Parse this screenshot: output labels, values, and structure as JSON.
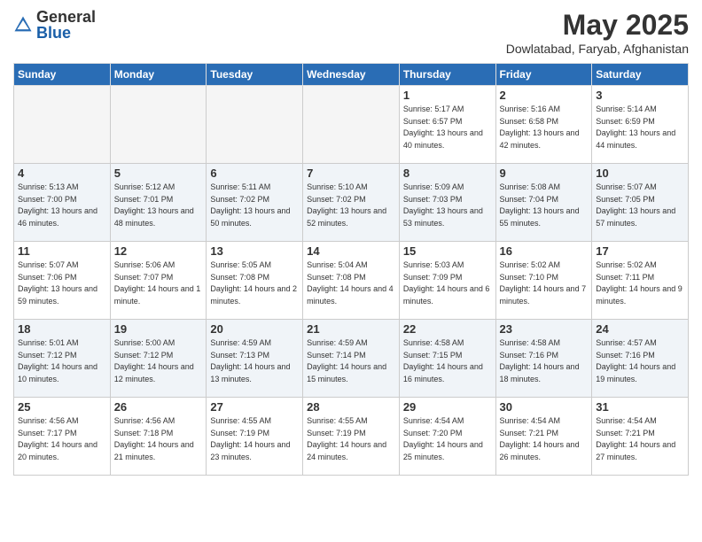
{
  "logo": {
    "general": "General",
    "blue": "Blue"
  },
  "title": {
    "month_year": "May 2025",
    "location": "Dowlatabad, Faryab, Afghanistan"
  },
  "weekdays": [
    "Sunday",
    "Monday",
    "Tuesday",
    "Wednesday",
    "Thursday",
    "Friday",
    "Saturday"
  ],
  "weeks": [
    [
      {
        "day": "",
        "empty": true
      },
      {
        "day": "",
        "empty": true
      },
      {
        "day": "",
        "empty": true
      },
      {
        "day": "",
        "empty": true
      },
      {
        "day": "1",
        "sunrise": "5:17 AM",
        "sunset": "6:57 PM",
        "daylight": "13 hours and 40 minutes."
      },
      {
        "day": "2",
        "sunrise": "5:16 AM",
        "sunset": "6:58 PM",
        "daylight": "13 hours and 42 minutes."
      },
      {
        "day": "3",
        "sunrise": "5:14 AM",
        "sunset": "6:59 PM",
        "daylight": "13 hours and 44 minutes."
      }
    ],
    [
      {
        "day": "4",
        "sunrise": "5:13 AM",
        "sunset": "7:00 PM",
        "daylight": "13 hours and 46 minutes."
      },
      {
        "day": "5",
        "sunrise": "5:12 AM",
        "sunset": "7:01 PM",
        "daylight": "13 hours and 48 minutes."
      },
      {
        "day": "6",
        "sunrise": "5:11 AM",
        "sunset": "7:02 PM",
        "daylight": "13 hours and 50 minutes."
      },
      {
        "day": "7",
        "sunrise": "5:10 AM",
        "sunset": "7:02 PM",
        "daylight": "13 hours and 52 minutes."
      },
      {
        "day": "8",
        "sunrise": "5:09 AM",
        "sunset": "7:03 PM",
        "daylight": "13 hours and 53 minutes."
      },
      {
        "day": "9",
        "sunrise": "5:08 AM",
        "sunset": "7:04 PM",
        "daylight": "13 hours and 55 minutes."
      },
      {
        "day": "10",
        "sunrise": "5:07 AM",
        "sunset": "7:05 PM",
        "daylight": "13 hours and 57 minutes."
      }
    ],
    [
      {
        "day": "11",
        "sunrise": "5:07 AM",
        "sunset": "7:06 PM",
        "daylight": "13 hours and 59 minutes."
      },
      {
        "day": "12",
        "sunrise": "5:06 AM",
        "sunset": "7:07 PM",
        "daylight": "14 hours and 1 minute."
      },
      {
        "day": "13",
        "sunrise": "5:05 AM",
        "sunset": "7:08 PM",
        "daylight": "14 hours and 2 minutes."
      },
      {
        "day": "14",
        "sunrise": "5:04 AM",
        "sunset": "7:08 PM",
        "daylight": "14 hours and 4 minutes."
      },
      {
        "day": "15",
        "sunrise": "5:03 AM",
        "sunset": "7:09 PM",
        "daylight": "14 hours and 6 minutes."
      },
      {
        "day": "16",
        "sunrise": "5:02 AM",
        "sunset": "7:10 PM",
        "daylight": "14 hours and 7 minutes."
      },
      {
        "day": "17",
        "sunrise": "5:02 AM",
        "sunset": "7:11 PM",
        "daylight": "14 hours and 9 minutes."
      }
    ],
    [
      {
        "day": "18",
        "sunrise": "5:01 AM",
        "sunset": "7:12 PM",
        "daylight": "14 hours and 10 minutes."
      },
      {
        "day": "19",
        "sunrise": "5:00 AM",
        "sunset": "7:12 PM",
        "daylight": "14 hours and 12 minutes."
      },
      {
        "day": "20",
        "sunrise": "4:59 AM",
        "sunset": "7:13 PM",
        "daylight": "14 hours and 13 minutes."
      },
      {
        "day": "21",
        "sunrise": "4:59 AM",
        "sunset": "7:14 PM",
        "daylight": "14 hours and 15 minutes."
      },
      {
        "day": "22",
        "sunrise": "4:58 AM",
        "sunset": "7:15 PM",
        "daylight": "14 hours and 16 minutes."
      },
      {
        "day": "23",
        "sunrise": "4:58 AM",
        "sunset": "7:16 PM",
        "daylight": "14 hours and 18 minutes."
      },
      {
        "day": "24",
        "sunrise": "4:57 AM",
        "sunset": "7:16 PM",
        "daylight": "14 hours and 19 minutes."
      }
    ],
    [
      {
        "day": "25",
        "sunrise": "4:56 AM",
        "sunset": "7:17 PM",
        "daylight": "14 hours and 20 minutes."
      },
      {
        "day": "26",
        "sunrise": "4:56 AM",
        "sunset": "7:18 PM",
        "daylight": "14 hours and 21 minutes."
      },
      {
        "day": "27",
        "sunrise": "4:55 AM",
        "sunset": "7:19 PM",
        "daylight": "14 hours and 23 minutes."
      },
      {
        "day": "28",
        "sunrise": "4:55 AM",
        "sunset": "7:19 PM",
        "daylight": "14 hours and 24 minutes."
      },
      {
        "day": "29",
        "sunrise": "4:54 AM",
        "sunset": "7:20 PM",
        "daylight": "14 hours and 25 minutes."
      },
      {
        "day": "30",
        "sunrise": "4:54 AM",
        "sunset": "7:21 PM",
        "daylight": "14 hours and 26 minutes."
      },
      {
        "day": "31",
        "sunrise": "4:54 AM",
        "sunset": "7:21 PM",
        "daylight": "14 hours and 27 minutes."
      }
    ]
  ]
}
